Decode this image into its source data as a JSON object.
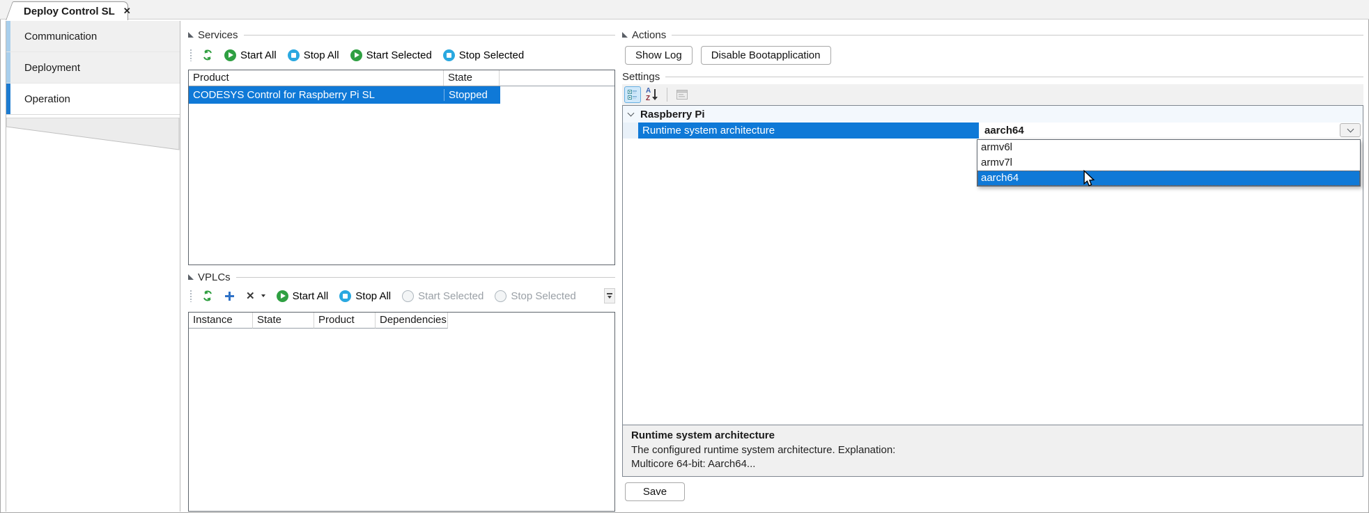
{
  "window": {
    "tab_title": "Deploy Control SL",
    "close_glyph": "✕"
  },
  "sidebar": {
    "items": [
      {
        "label": "Communication"
      },
      {
        "label": "Deployment"
      },
      {
        "label": "Operation"
      }
    ]
  },
  "services": {
    "title": "Services",
    "toolbar": {
      "start_all": "Start All",
      "stop_all": "Stop All",
      "start_selected": "Start Selected",
      "stop_selected": "Stop Selected"
    },
    "columns": [
      "Product",
      "State"
    ],
    "rows": [
      {
        "product": "CODESYS Control for Raspberry Pi SL",
        "state": "Stopped",
        "selected": true
      }
    ]
  },
  "vplcs": {
    "title": "VPLCs",
    "toolbar": {
      "start_all": "Start All",
      "stop_all": "Stop All",
      "start_selected": "Start Selected",
      "stop_selected": "Stop Selected"
    },
    "columns": [
      "Instance",
      "State",
      "Product",
      "Dependencies"
    ],
    "rows": []
  },
  "actions": {
    "title": "Actions",
    "show_log": "Show Log",
    "disable_boot": "Disable Bootapplication"
  },
  "settings": {
    "title": "Settings",
    "category": "Raspberry Pi",
    "property": {
      "name": "Runtime system architecture",
      "value": "aarch64"
    },
    "dropdown": {
      "options": [
        "armv6l",
        "armv7l",
        "aarch64"
      ],
      "selected": "aarch64"
    }
  },
  "description": {
    "title": "Runtime system architecture",
    "line1": "The configured runtime system architecture. Explanation:",
    "line2": "Multicore 64-bit: Aarch64..."
  },
  "save_label": "Save",
  "colors": {
    "selection_blue": "#0f79d7",
    "sidebar_accent_active": "#1d7bd0",
    "sidebar_accent": "#a9cfec",
    "icon_green": "#2fa042",
    "icon_blue": "#29a8e0"
  }
}
